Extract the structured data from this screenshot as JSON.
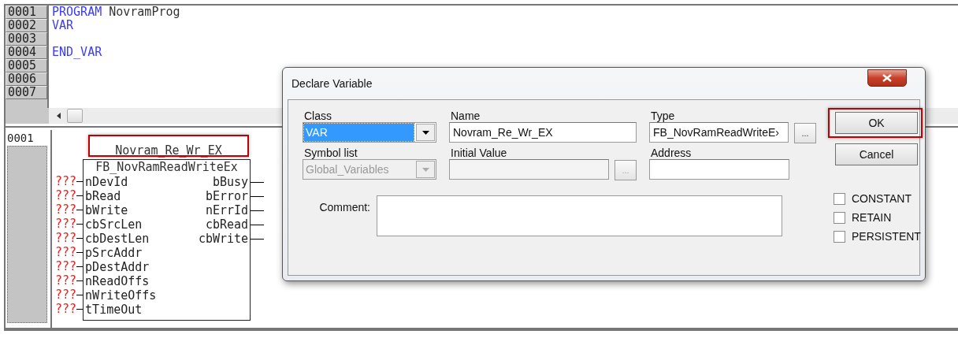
{
  "declaration": {
    "lines": [
      {
        "number": "0001",
        "keyword": "PROGRAM",
        "text": "NovramProg"
      },
      {
        "number": "0002",
        "keyword": "VAR"
      },
      {
        "number": "0003"
      },
      {
        "number": "0004",
        "keyword": "END_VAR"
      },
      {
        "number": "0005"
      },
      {
        "number": "0006"
      },
      {
        "number": "0007"
      }
    ]
  },
  "network": {
    "number": "0001",
    "instance": {
      "name": "Novram_Re_Wr_EX",
      "highlighted": true
    },
    "block": {
      "type": "FB_NovRamReadWriteEx",
      "inputs": [
        {
          "name": "nDevId",
          "value": "???"
        },
        {
          "name": "bRead",
          "value": "???"
        },
        {
          "name": "bWrite",
          "value": "???"
        },
        {
          "name": "cbSrcLen",
          "value": "???"
        },
        {
          "name": "cbDestLen",
          "value": "???"
        },
        {
          "name": "pSrcAddr",
          "value": "???"
        },
        {
          "name": "pDestAddr",
          "value": "???"
        },
        {
          "name": "nReadOffs",
          "value": "???"
        },
        {
          "name": "nWriteOffs",
          "value": "???"
        },
        {
          "name": "tTimeOut",
          "value": "???"
        }
      ],
      "outputs": [
        "bBusy",
        "bError",
        "nErrId",
        "cbRead",
        "cbWrite"
      ]
    }
  },
  "dialog": {
    "title": "Declare Variable",
    "class": {
      "label": "Class",
      "value": "VAR",
      "selected": true
    },
    "name": {
      "label": "Name",
      "value": "Novram_Re_Wr_EX"
    },
    "type": {
      "label": "Type",
      "value": "FB_NovRamReadWriteE›",
      "browse": "..."
    },
    "symbol_list": {
      "label": "Symbol list",
      "value": "Global_Variables",
      "disabled": true
    },
    "initial_value": {
      "label": "Initial Value",
      "browse": "...",
      "disabled": true
    },
    "address": {
      "label": "Address"
    },
    "comment": {
      "label": "Comment:"
    },
    "buttons": [
      {
        "label": "OK",
        "highlighted": true
      },
      {
        "label": "Cancel",
        "highlighted": false
      }
    ],
    "options": [
      {
        "label": "CONSTANT",
        "checked": false
      },
      {
        "label": "RETAIN",
        "checked": false
      },
      {
        "label": "PERSISTENT",
        "checked": false
      }
    ]
  }
}
